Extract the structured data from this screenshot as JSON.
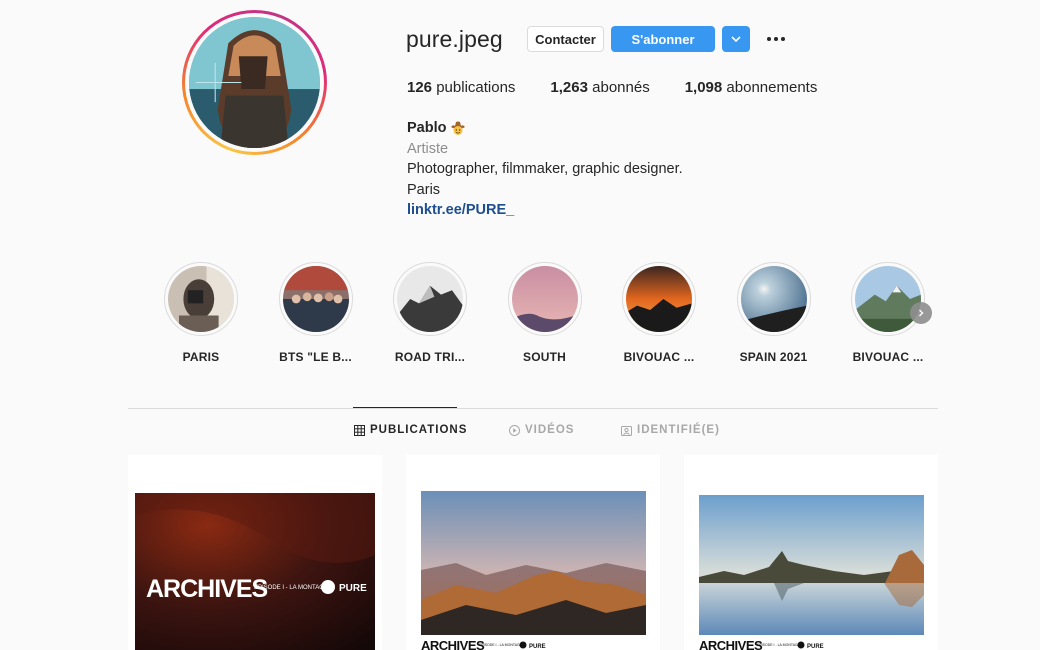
{
  "profile": {
    "username": "pure.jpeg",
    "contact_label": "Contacter",
    "follow_label": "S'abonner",
    "publications_count": "126",
    "publications_label": "publications",
    "followers_count": "1,263",
    "followers_label": "abonnés",
    "following_count": "1,098",
    "following_label": "abonnements",
    "name": "Pablo",
    "category": "Artiste",
    "bio_line1": "Photographer, filmmaker, graphic designer.",
    "bio_line2": "Paris",
    "link": "linktr.ee/PURE_"
  },
  "highlights": [
    {
      "label": "PARIS"
    },
    {
      "label": "BTS \"LE B..."
    },
    {
      "label": "ROAD TRI..."
    },
    {
      "label": "SOUTH"
    },
    {
      "label": "BIVOUAC ..."
    },
    {
      "label": "SPAIN 2021"
    },
    {
      "label": "BIVOUAC ..."
    }
  ],
  "tabs": [
    {
      "label": "PUBLICATIONS",
      "icon": "grid-icon",
      "active": true
    },
    {
      "label": "VIDÉOS",
      "icon": "play-icon",
      "active": false
    },
    {
      "label": "IDENTIFIÉ(E)",
      "icon": "tag-icon",
      "active": false
    }
  ],
  "posts": [
    {
      "title": "ARCHIVES",
      "subtitle": "EPISODE I - LA MONTAGNE",
      "brand": "PURE"
    },
    {
      "title": "ARCHIVES",
      "subtitle": "EPISODE I - LA MONTAGNE",
      "brand": "PURE"
    },
    {
      "title": "ARCHIVES",
      "subtitle": "EPISODE I - LA MONTAGNE",
      "brand": "PURE"
    }
  ],
  "colors": {
    "accent": "#3897f0",
    "link": "#1d4e8f",
    "text": "#262626",
    "muted": "#8e8e8e",
    "background": "#fafafa"
  }
}
